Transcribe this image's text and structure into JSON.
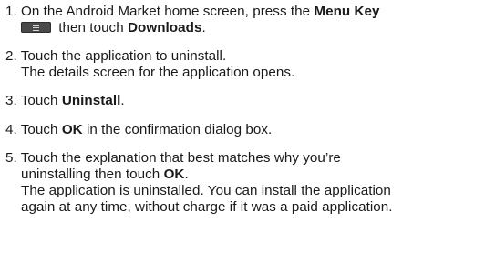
{
  "steps": {
    "s1": {
      "prefix": "1. On the Android Market home screen, press the ",
      "menu_key": "Menu Key",
      "then": " then touch ",
      "downloads": "Downloads",
      "end": "."
    },
    "s2": {
      "line1": "2. Touch the application to uninstall.",
      "line2": "The details screen for the application opens."
    },
    "s3": {
      "prefix": "3. Touch ",
      "uninstall": "Uninstall",
      "end": "."
    },
    "s4": {
      "prefix": "4. Touch ",
      "ok": "OK",
      "suffix": " in the confirmation dialog box."
    },
    "s5": {
      "line1": "5. Touch the explanation that best matches why you’re",
      "line2_prefix": "uninstalling then touch ",
      "ok": "OK",
      "end": ".",
      "line3": "The application is uninstalled. You can install the application",
      "line4": "again at any time, without charge if it was a paid application."
    }
  },
  "icons": {
    "menu_key_icon": "menu-key-icon"
  }
}
